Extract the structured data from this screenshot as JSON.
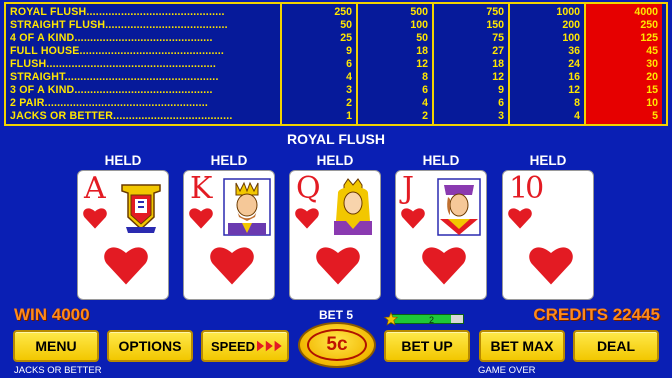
{
  "paytable": {
    "hands": [
      "ROYAL FLUSH",
      "STRAIGHT FLUSH",
      "4 OF A KIND",
      "FULL HOUSE",
      "FLUSH",
      "STRAIGHT",
      "3 OF A KIND",
      "2 PAIR",
      "JACKS OR BETTER"
    ],
    "columns": [
      {
        "values": [
          "250",
          "50",
          "25",
          "9",
          "6",
          "4",
          "3",
          "2",
          "1"
        ],
        "highlighted": false
      },
      {
        "values": [
          "500",
          "100",
          "50",
          "18",
          "12",
          "8",
          "6",
          "4",
          "2"
        ],
        "highlighted": false
      },
      {
        "values": [
          "750",
          "150",
          "75",
          "27",
          "18",
          "12",
          "9",
          "6",
          "3"
        ],
        "highlighted": false
      },
      {
        "values": [
          "1000",
          "200",
          "100",
          "36",
          "24",
          "16",
          "12",
          "8",
          "4"
        ],
        "highlighted": false
      },
      {
        "values": [
          "4000",
          "250",
          "125",
          "45",
          "30",
          "20",
          "15",
          "10",
          "5"
        ],
        "highlighted": true
      }
    ]
  },
  "result_text": "ROYAL FLUSH",
  "cards": [
    {
      "rank": "A",
      "suit": "hearts",
      "held_label": "HELD"
    },
    {
      "rank": "K",
      "suit": "hearts",
      "held_label": "HELD"
    },
    {
      "rank": "Q",
      "suit": "hearts",
      "held_label": "HELD"
    },
    {
      "rank": "J",
      "suit": "hearts",
      "held_label": "HELD"
    },
    {
      "rank": "10",
      "suit": "hearts",
      "held_label": "HELD"
    }
  ],
  "win_text": "WIN 4000",
  "credits_text": "CREDITS 22445",
  "bet_text": "BET 5",
  "speed_level": "2",
  "buttons": {
    "menu": "MENU",
    "options": "OPTIONS",
    "speed": "SPEED",
    "coin": "5c",
    "bet_up": "BET UP",
    "bet_max": "BET MAX",
    "deal": "DEAL"
  },
  "footer": {
    "game_name": "JACKS OR BETTER",
    "status": "GAME OVER"
  },
  "colors": {
    "background": "#0a1fb4",
    "paytable_text": "#ffe600",
    "highlight": "#e60000",
    "button": "#f2c700",
    "win_credits": "#ff8a1a",
    "card_red": "#e31b23"
  }
}
